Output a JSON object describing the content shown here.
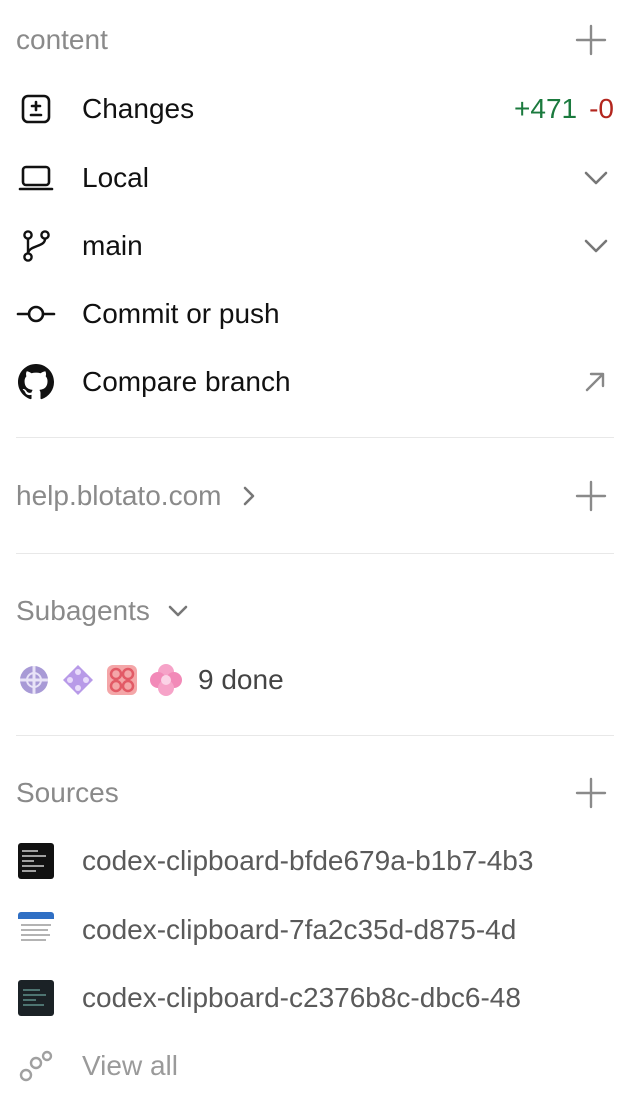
{
  "content": {
    "title": "content",
    "add_icon": "plus-icon"
  },
  "items": [
    {
      "label": "Changes",
      "icon": "diff-icon",
      "added": "+471",
      "removed": "-0"
    },
    {
      "label": "Local",
      "icon": "laptop-icon"
    },
    {
      "label": "main",
      "icon": "branch-icon"
    },
    {
      "label": "Commit or push",
      "icon": "commit-icon"
    },
    {
      "label": "Compare branch",
      "icon": "github-icon"
    }
  ],
  "site": {
    "title": "help.blotato.com",
    "chevron_icon": "chevron-right-icon"
  },
  "subagents": {
    "title": "Subagents",
    "status": "9 done"
  },
  "sources": {
    "title": "Sources",
    "files": [
      "codex-clipboard-bfde679a-b1b7-4b3",
      "codex-clipboard-7fa2c35d-d875-4d",
      "codex-clipboard-c2376b8c-dbc6-48"
    ],
    "view_all": "View all"
  },
  "colors": {
    "added": "#1b7a3e",
    "removed": "#b3261e",
    "muted": "#8a8a8a"
  }
}
